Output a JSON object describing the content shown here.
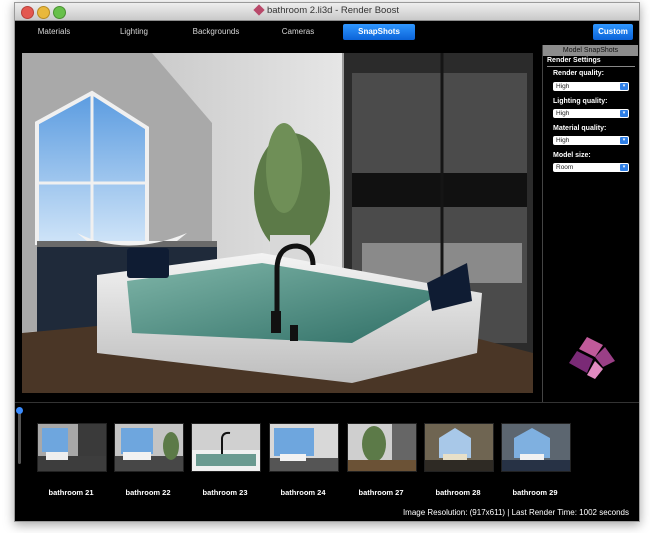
{
  "window": {
    "title": "bathroom 2.li3d - Render Boost"
  },
  "tabs": [
    {
      "label": "Materials"
    },
    {
      "label": "Lighting"
    },
    {
      "label": "Backgrounds"
    },
    {
      "label": "Cameras"
    },
    {
      "label": "SnapShots"
    }
  ],
  "active_tab": "SnapShots",
  "custom_button": "Custom",
  "panel": {
    "title": "Model SnapShots",
    "section": "Render Settings",
    "fields": [
      {
        "label": "Render quality:",
        "value": "High"
      },
      {
        "label": "Lighting quality:",
        "value": "High"
      },
      {
        "label": "Material quality:",
        "value": "High"
      },
      {
        "label": "Model size:",
        "value": "Room"
      }
    ]
  },
  "snapshots": [
    {
      "label": "bathroom 21"
    },
    {
      "label": "bathroom 22"
    },
    {
      "label": "bathroom 23"
    },
    {
      "label": "bathroom 24"
    },
    {
      "label": "bathroom 27"
    },
    {
      "label": "bathroom 28"
    },
    {
      "label": "bathroom 29"
    }
  ],
  "status": {
    "text": "Image Resolution: (917x611)  |  Last Render Time: 1002 seconds"
  },
  "colors": {
    "accent": "#1a7cf0",
    "window_bg": "#000000",
    "panel_header": "#8c8c8c"
  }
}
